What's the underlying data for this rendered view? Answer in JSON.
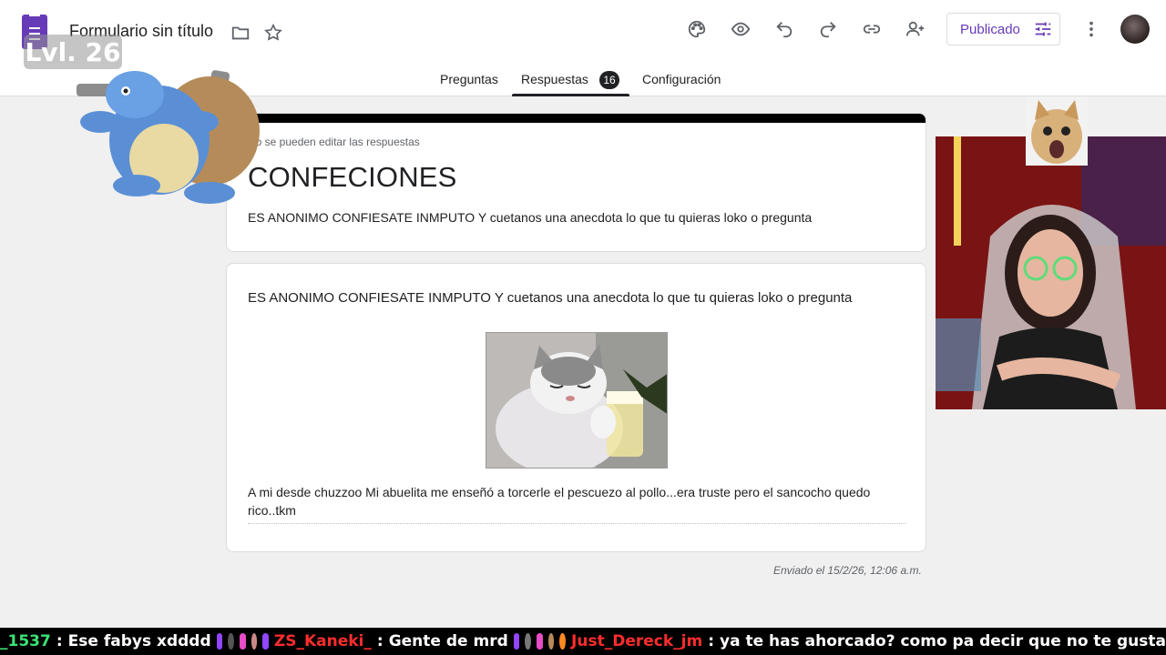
{
  "header": {
    "title": "Formulario sin título",
    "publish_label": "Publicado"
  },
  "tabs": [
    {
      "label": "Preguntas"
    },
    {
      "label": "Respuestas",
      "badge": "16"
    },
    {
      "label": "Configuración"
    }
  ],
  "form": {
    "no_edit_notice": "No se pueden editar las respuestas",
    "title": "CONFECIONES",
    "description": "ES ANONIMO CONFIESATE INMPUTO Y cuetanos una anecdota lo que tu quieras loko o pregunta"
  },
  "question": {
    "title": "ES ANONIMO CONFIESATE INMPUTO Y cuetanos una anecdota lo que tu quieras loko o pregunta",
    "answer": " A mi desde chuzzoo Mi abuelita me enseñó a torcerle el pescuezo al pollo...era truste pero el sancocho quedo rico..tkm"
  },
  "sent_timestamp": "Enviado el 15/2/26, 12:06 a.m.",
  "overlay": {
    "level": "Lvl. 26"
  },
  "chat": [
    {
      "user": "_1537",
      "sep": ":",
      "message": "Ese fabys xdddd",
      "user_color": "#3ae374"
    },
    {
      "user": "ZS_Kaneki_",
      "sep": ":",
      "message": "Gente de mrd",
      "user_color": "#ff2d2d"
    },
    {
      "user": "Just_Dereck_jm",
      "sep": ":",
      "message": "ya te has ahorcado? como pa decir que no te gusta",
      "user_color": "#ff2d2d"
    }
  ],
  "colors": {
    "accent": "#673ab7",
    "background": "#f0f0f0",
    "form_bar": "#000000"
  }
}
